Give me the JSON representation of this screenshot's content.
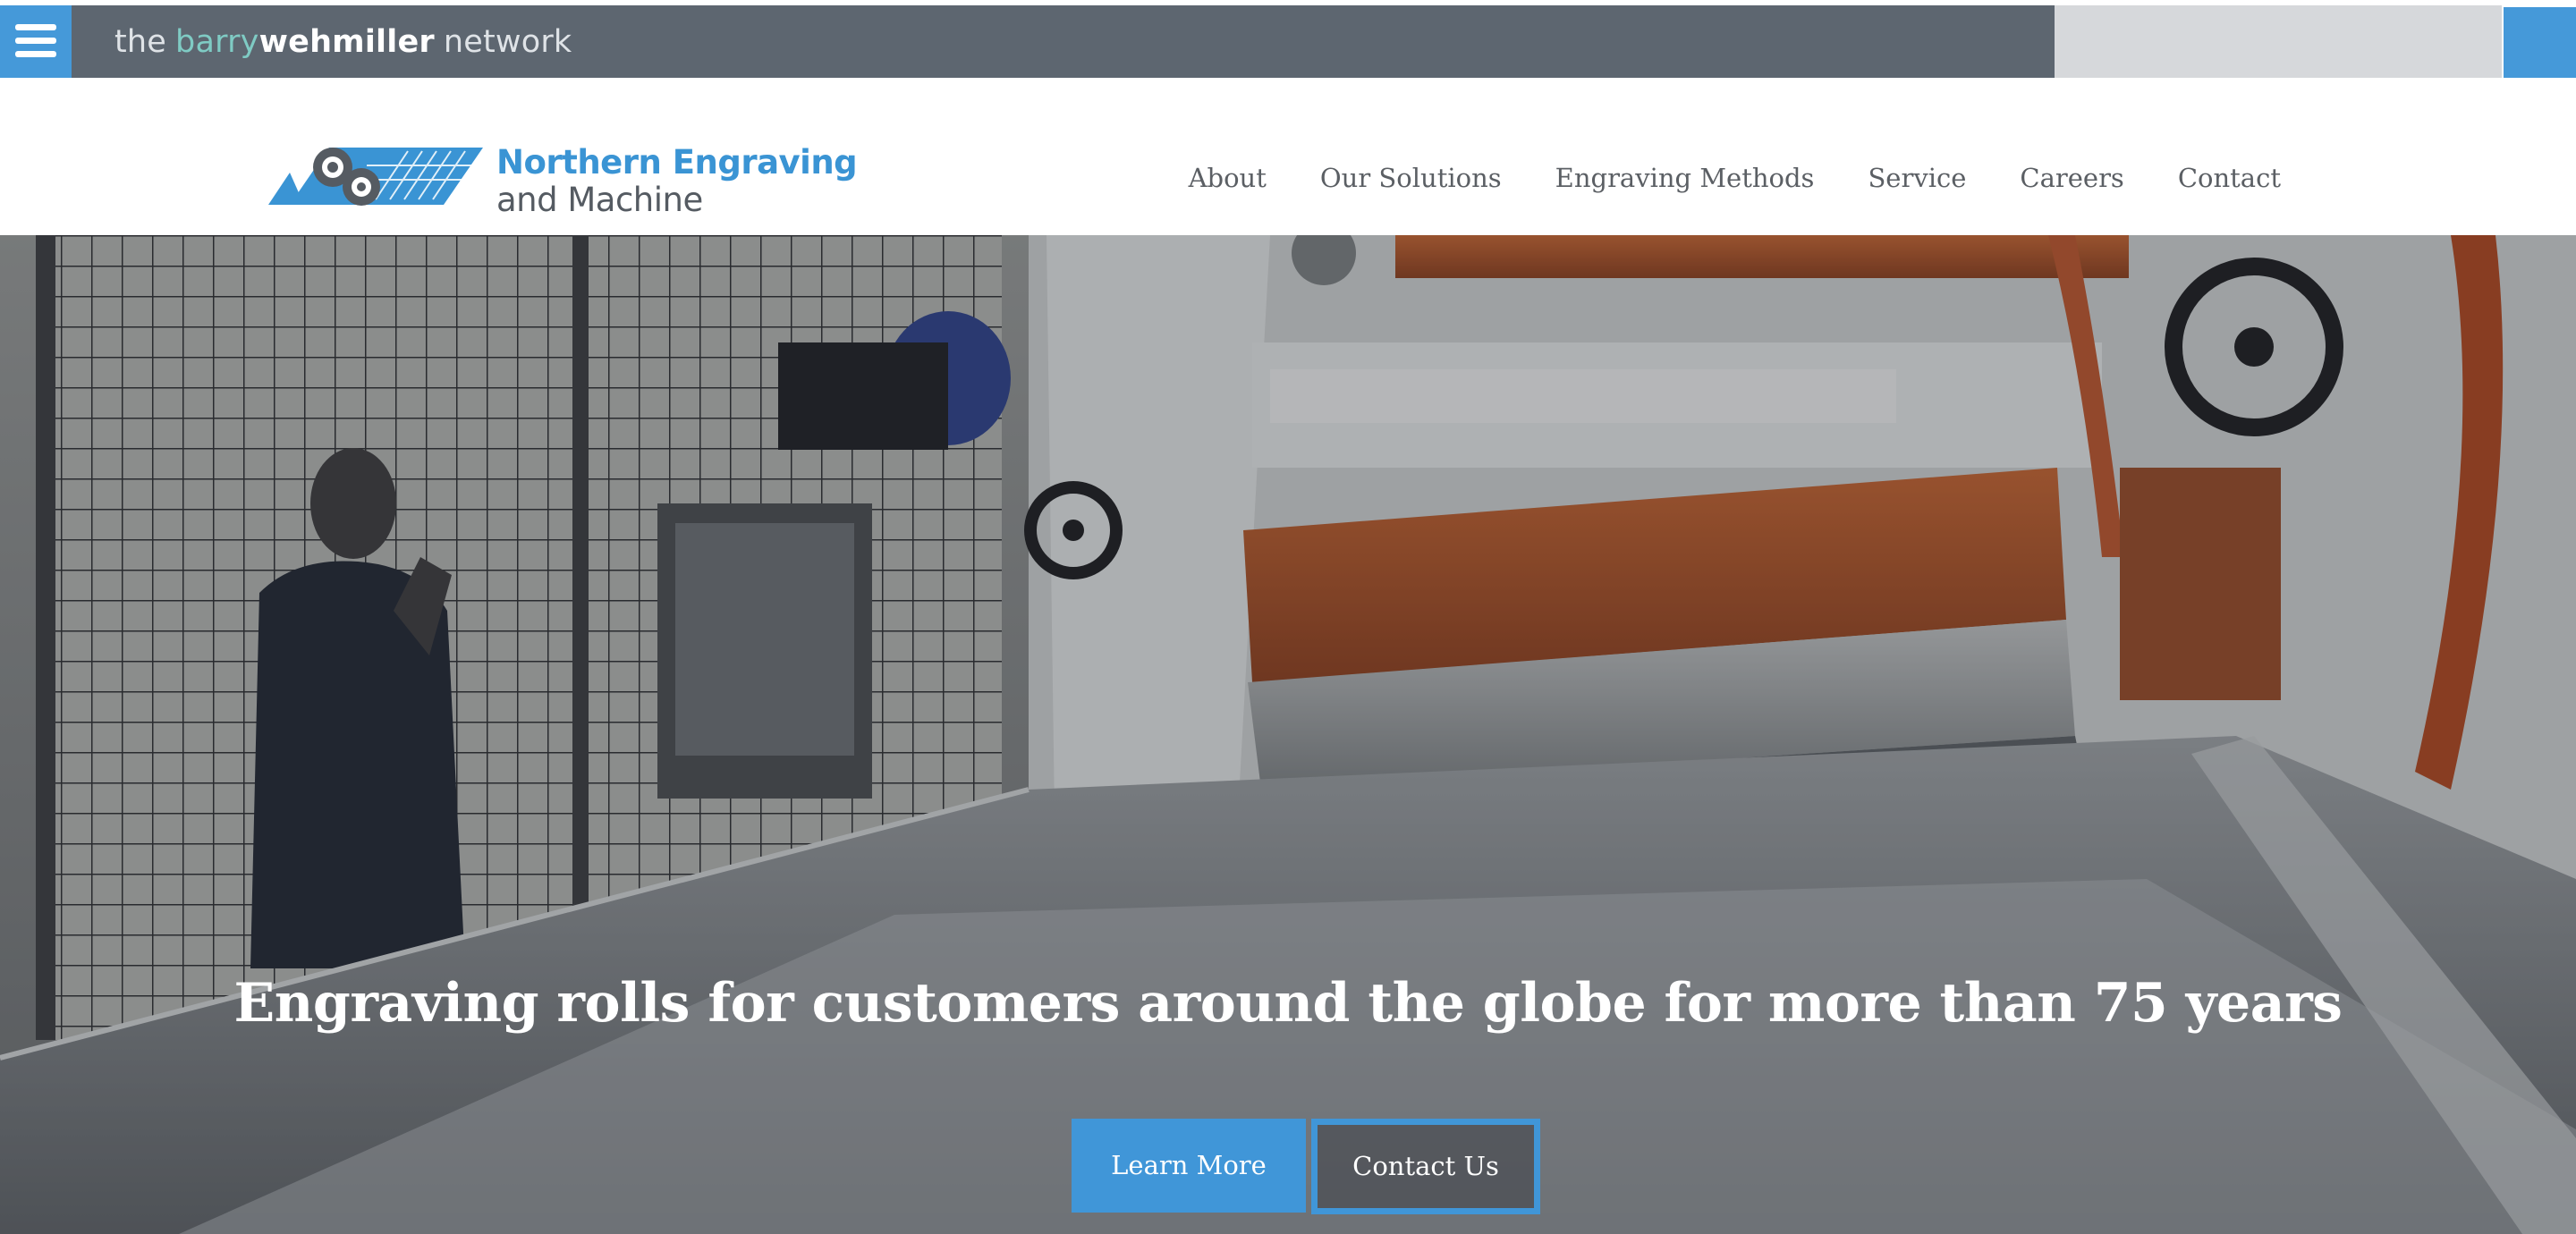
{
  "network_bar": {
    "brand_prefix": "the",
    "brand_barry": "barry",
    "brand_wehmiller": "wehmiller",
    "brand_suffix": "network",
    "menu_icon": "hamburger-menu-icon",
    "colors": {
      "bar": "#5d6670",
      "accent": "#4599d9",
      "barry": "#7fcbc4"
    }
  },
  "header": {
    "logo": {
      "line1": "Northern Engraving",
      "line2": "and Machine",
      "icon": "engraving-roll-logo-icon",
      "colors": {
        "primary": "#3a94d4",
        "secondary": "#555b62"
      }
    },
    "nav": [
      {
        "label": "About"
      },
      {
        "label": "Our Solutions"
      },
      {
        "label": "Engraving Methods"
      },
      {
        "label": "Service"
      },
      {
        "label": "Careers"
      },
      {
        "label": "Contact"
      }
    ]
  },
  "hero": {
    "heading": "Engraving rolls for customers around the globe for more than 75 years",
    "primary_button": "Learn More",
    "secondary_button": "Contact Us",
    "image": "factory-engraving-machine-photo",
    "colors": {
      "button": "#4096d8"
    }
  }
}
